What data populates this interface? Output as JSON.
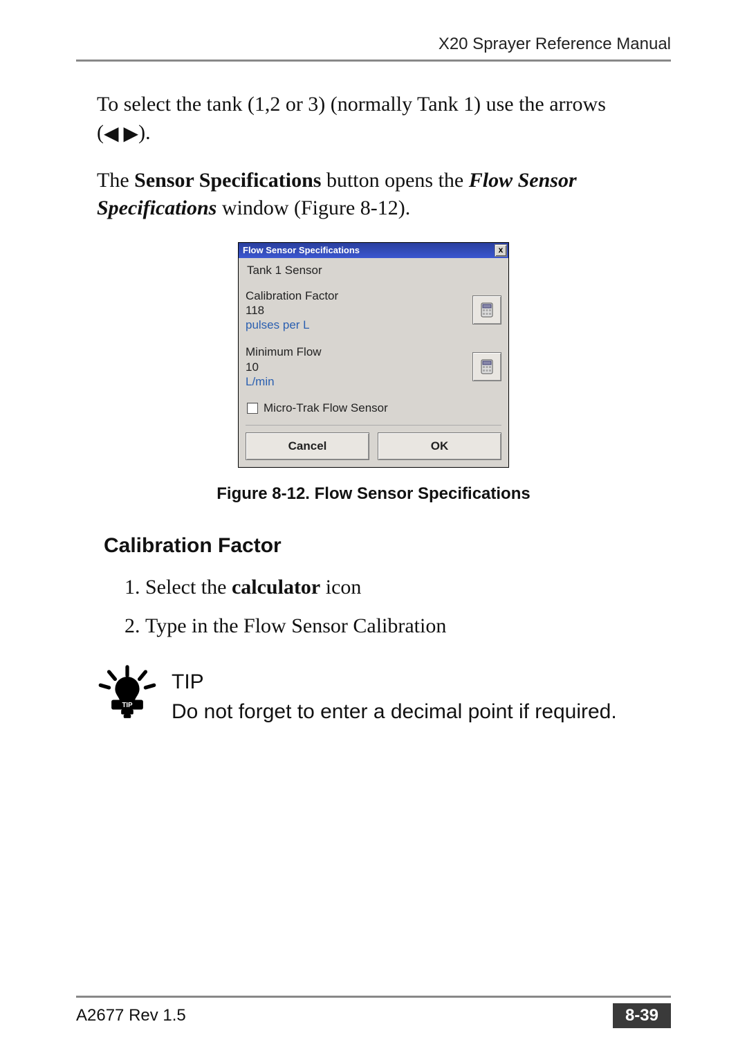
{
  "header": {
    "title": "X20 Sprayer Reference Manual"
  },
  "body": {
    "para1_a": "To select the tank (1,2 or 3) (normally Tank 1) use the arrows (",
    "para1_arrows": "◀ ▶",
    "para1_b": ").",
    "para2_a": "The ",
    "para2_b": "Sensor Specifications",
    "para2_c": " button opens the ",
    "para2_d": "Flow Sensor Specifications",
    "para2_e": " window (Figure 8-12)."
  },
  "dialog": {
    "title": "Flow Sensor Specifications",
    "close": "x",
    "tank_label": "Tank 1 Sensor",
    "calibration": {
      "label": "Calibration Factor",
      "value": "118",
      "unit": "pulses per L"
    },
    "minflow": {
      "label": "Minimum Flow",
      "value": "10",
      "unit": "L/min"
    },
    "microtrak": "Micro-Trak Flow Sensor",
    "cancel": "Cancel",
    "ok": "OK"
  },
  "figure_caption": "Figure 8-12. Flow Sensor Specifications",
  "section_heading": "Calibration Factor",
  "list": {
    "item1_a": "Select the ",
    "item1_b": "calculator",
    "item1_c": " icon",
    "item2": "Type in the Flow Sensor Calibration"
  },
  "tip": {
    "label": "TIP",
    "badge": "TIP",
    "text": "Do not forget to enter a decimal point if required."
  },
  "footer": {
    "doc_rev": "A2677 Rev 1.5",
    "page": "8-39"
  }
}
